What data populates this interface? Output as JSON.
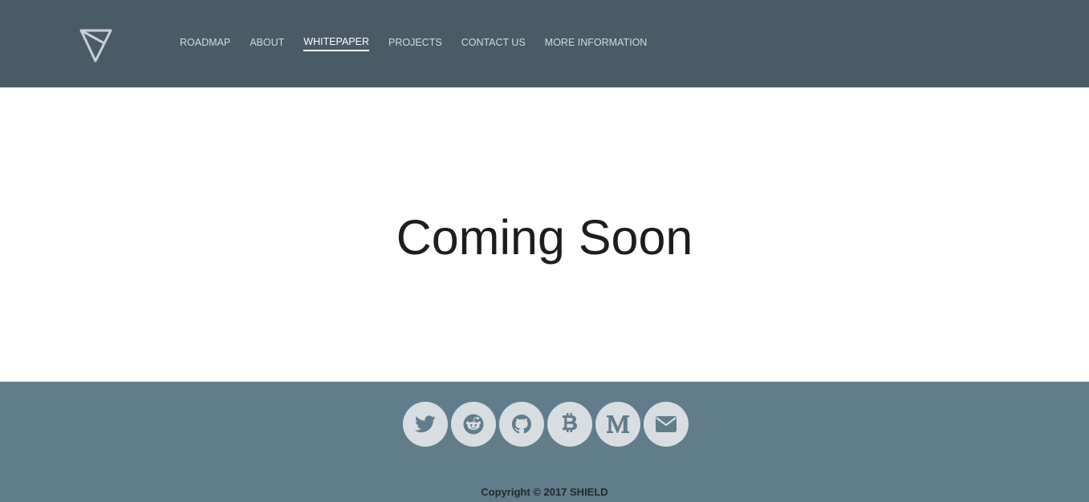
{
  "header": {
    "logo_icon": "triangle-logo-icon",
    "nav": [
      {
        "label": "ROADMAP",
        "active": false
      },
      {
        "label": "ABOUT",
        "active": false
      },
      {
        "label": "WHITEPAPER",
        "active": true
      },
      {
        "label": "PROJECTS",
        "active": false
      },
      {
        "label": "CONTACT US",
        "active": false
      },
      {
        "label": "MORE INFORMATION",
        "active": false
      }
    ]
  },
  "main": {
    "title": "Coming Soon"
  },
  "footer": {
    "social": [
      {
        "icon": "twitter-icon"
      },
      {
        "icon": "reddit-icon"
      },
      {
        "icon": "github-icon"
      },
      {
        "icon": "bitcoin-icon"
      },
      {
        "icon": "medium-icon"
      },
      {
        "icon": "envelope-icon"
      }
    ],
    "copyright": "Copyright © 2017  SHIELD"
  },
  "colors": {
    "header_bg": "#485b67",
    "footer_bg": "#617c8a",
    "social_bg": "#d7dde0",
    "icon_color": "#617c8a"
  }
}
